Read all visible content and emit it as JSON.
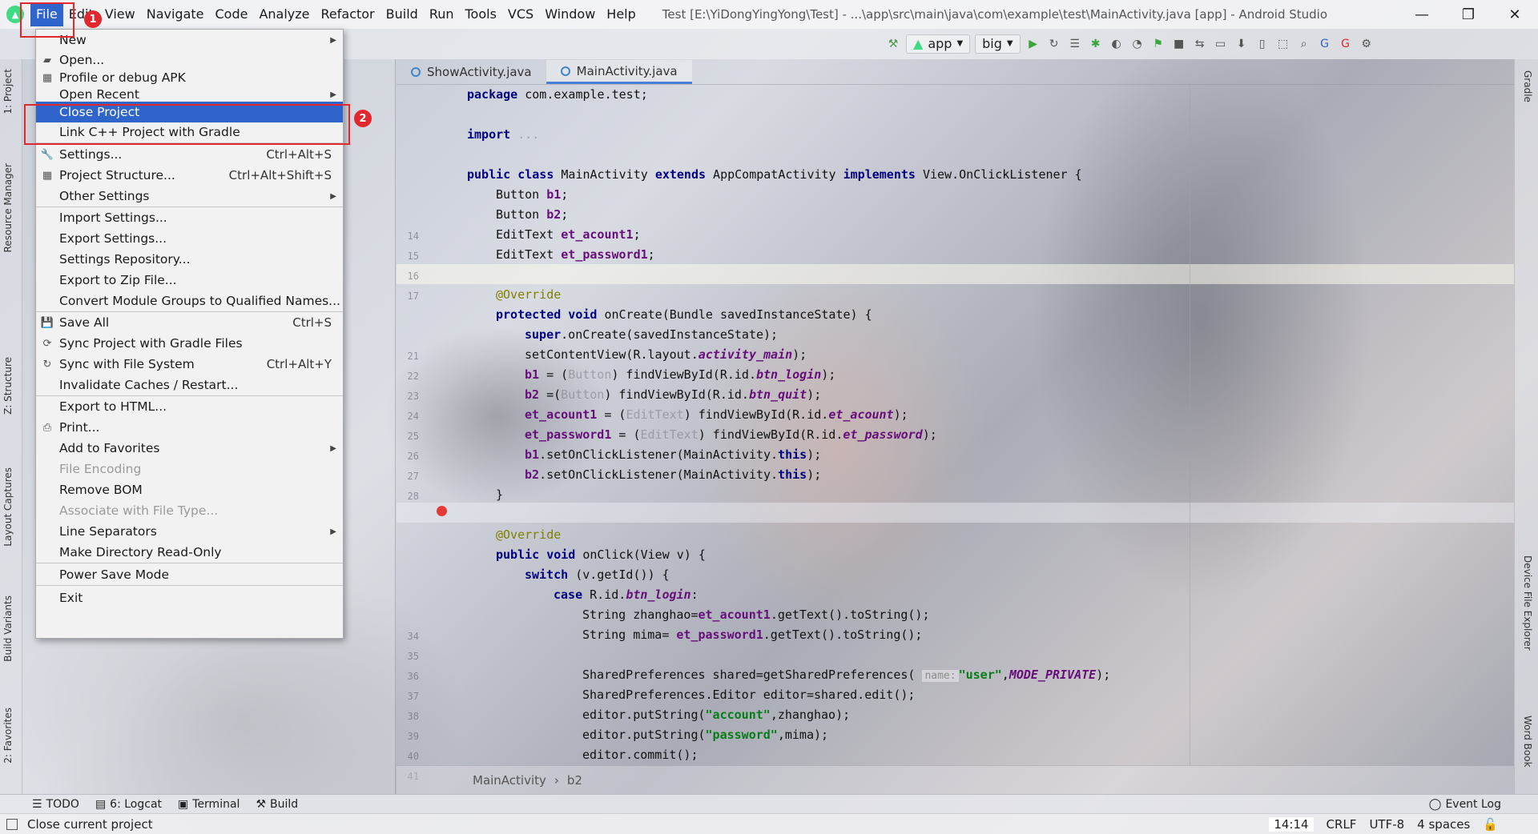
{
  "menubar": {
    "items": [
      "File",
      "Edit",
      "View",
      "Navigate",
      "Code",
      "Analyze",
      "Refactor",
      "Build",
      "Run",
      "Tools",
      "VCS",
      "Window",
      "Help"
    ],
    "window_title": "Test [E:\\YiDongYingYong\\Test] - ...\\app\\src\\main\\java\\com\\example\\test\\MainActivity.java [app] - Android Studio"
  },
  "toolbar": {
    "run_config": "app",
    "device": "big"
  },
  "left_tabs": [
    "1: Project",
    "Resource Manager",
    "Z: Structure",
    "Layout Captures",
    "Build Variants",
    "2: Favorites"
  ],
  "right_tabs": [
    "Gradle",
    "Device File Explorer",
    "Word Book"
  ],
  "editor": {
    "tabs": [
      "ShowActivity.java",
      "MainActivity.java"
    ],
    "active_tab": "MainActivity.java",
    "line_numbers": [
      "14",
      "15",
      "16",
      "17",
      "",
      "21",
      "22",
      "23",
      "24",
      "25",
      "26",
      "27",
      "28",
      "",
      "",
      "",
      "34",
      "35",
      "36",
      "37",
      "38",
      "39",
      "40",
      "41"
    ],
    "breadcrumb": [
      "MainActivity",
      "b2"
    ],
    "code": {
      "l1_kw": "package",
      "l1_rest": " com.example.test;",
      "l2_kw": "import",
      "l2_rest": " ...",
      "l3_a": "public class",
      "l3_b": " MainActivity ",
      "l3_c": "extends",
      "l3_d": " AppCompatActivity ",
      "l3_e": "implements",
      "l3_f": " View.OnClickListener {",
      "l4_a": "Button ",
      "l4_b": "b1",
      "l4_c": ";",
      "l5_a": "Button ",
      "l5_b": "b2",
      "l5_c": ";",
      "l6_a": "EditText ",
      "l6_b": "et_acount1",
      "l6_c": ";",
      "l7_a": "EditText ",
      "l7_b": "et_password1",
      "l7_c": ";",
      "l8": "@Override",
      "l9_a": "protected void",
      "l9_b": " onCreate(Bundle savedInstanceState) {",
      "l10_a": "super",
      "l10_b": ".onCreate(savedInstanceState);",
      "l11_a": "setContentView(R.layout.",
      "l11_b": "activity_main",
      "l11_c": ");",
      "l12_a": "b1",
      "l12_b": " = (",
      "l12_c": "Button",
      "l12_d": ") findViewById(R.id.",
      "l12_e": "btn_login",
      "l12_f": ");",
      "l13_a": "b2",
      "l13_b": " =(",
      "l13_c": "Button",
      "l13_d": ") findViewById(R.id.",
      "l13_e": "btn_quit",
      "l13_f": ");",
      "l14_a": "et_acount1",
      "l14_b": " = (",
      "l14_c": "EditText",
      "l14_d": ") findViewById(R.id.",
      "l14_e": "et_acount",
      "l14_f": ");",
      "l15_a": "et_password1",
      "l15_b": " = (",
      "l15_c": "EditText",
      "l15_d": ") findViewById(R.id.",
      "l15_e": "et_password",
      "l15_f": ");",
      "l16_a": "b1",
      "l16_b": ".setOnClickListener(MainActivity.",
      "l16_c": "this",
      "l16_d": ");",
      "l17_a": "b2",
      "l17_b": ".setOnClickListener(MainActivity.",
      "l17_c": "this",
      "l17_d": ");",
      "l18": "}",
      "l19": "@Override",
      "l20_a": "public void",
      "l20_b": " onClick(View v) {",
      "l21_a": "switch",
      "l21_b": " (v.getId()) {",
      "l22_a": "case",
      "l22_b": " R.id.",
      "l22_c": "btn_login",
      "l22_d": ":",
      "l23_a": "String zhanghao=",
      "l23_b": "et_acount1",
      "l23_c": ".getText().toString();",
      "l24_a": "String mima= ",
      "l24_b": "et_password1",
      "l24_c": ".getText().toString();",
      "l25_a": "SharedPreferences shared=getSharedPreferences( ",
      "l25_hint": "name:",
      "l25_b": "\"user\"",
      "l25_c": ",",
      "l25_d": "MODE_PRIVATE",
      "l25_e": ");",
      "l26": "SharedPreferences.Editor editor=shared.edit();",
      "l27_a": "editor.putString(",
      "l27_b": "\"account\"",
      "l27_c": ",zhanghao);",
      "l28_a": "editor.putString(",
      "l28_b": "\"password\"",
      "l28_c": ",mima);",
      "l29": "editor.commit();"
    }
  },
  "file_menu": {
    "items": [
      {
        "label": "New",
        "submenu": true
      },
      {
        "label": "Open...",
        "icon": "folder-icon"
      },
      {
        "label": "Profile or debug APK",
        "icon": "apk-icon"
      },
      {
        "label": "Open Recent",
        "submenu": true
      },
      {
        "label": "Close Project",
        "selected": true
      },
      {
        "label": "Link C++ Project with Gradle"
      },
      {
        "label": "Settings...",
        "shortcut": "Ctrl+Alt+S",
        "icon": "wrench-icon"
      },
      {
        "label": "Project Structure...",
        "shortcut": "Ctrl+Alt+Shift+S",
        "icon": "project-structure-icon"
      },
      {
        "label": "Other Settings",
        "submenu": true
      },
      {
        "label": "Import Settings..."
      },
      {
        "label": "Export Settings..."
      },
      {
        "label": "Settings Repository..."
      },
      {
        "label": "Export to Zip File..."
      },
      {
        "label": "Convert Module Groups to Qualified Names..."
      },
      {
        "label": "Save All",
        "shortcut": "Ctrl+S",
        "icon": "save-icon"
      },
      {
        "label": "Sync Project with Gradle Files",
        "icon": "gradle-sync-icon"
      },
      {
        "label": "Sync with File System",
        "shortcut": "Ctrl+Alt+Y",
        "icon": "refresh-icon"
      },
      {
        "label": "Invalidate Caches / Restart..."
      },
      {
        "label": "Export to HTML..."
      },
      {
        "label": "Print...",
        "icon": "printer-icon"
      },
      {
        "label": "Add to Favorites",
        "submenu": true
      },
      {
        "label": "File Encoding",
        "disabled": true
      },
      {
        "label": "Remove BOM"
      },
      {
        "label": "Associate with File Type...",
        "disabled": true
      },
      {
        "label": "Line Separators",
        "submenu": true
      },
      {
        "label": "Make Directory Read-Only"
      },
      {
        "label": "Power Save Mode"
      },
      {
        "label": "Exit"
      }
    ]
  },
  "annotations": {
    "badge1": "1",
    "badge2": "2"
  },
  "bottom_tools": [
    "TODO",
    "6: Logcat",
    "Terminal",
    "Build"
  ],
  "event_log": "Event Log",
  "status": {
    "message": "Close current project",
    "position": "14:14",
    "line_sep": "CRLF",
    "encoding": "UTF-8",
    "indent": "4 spaces"
  },
  "colors": {
    "accent": "#2f65ca",
    "annotation_red": "#e0282e"
  }
}
